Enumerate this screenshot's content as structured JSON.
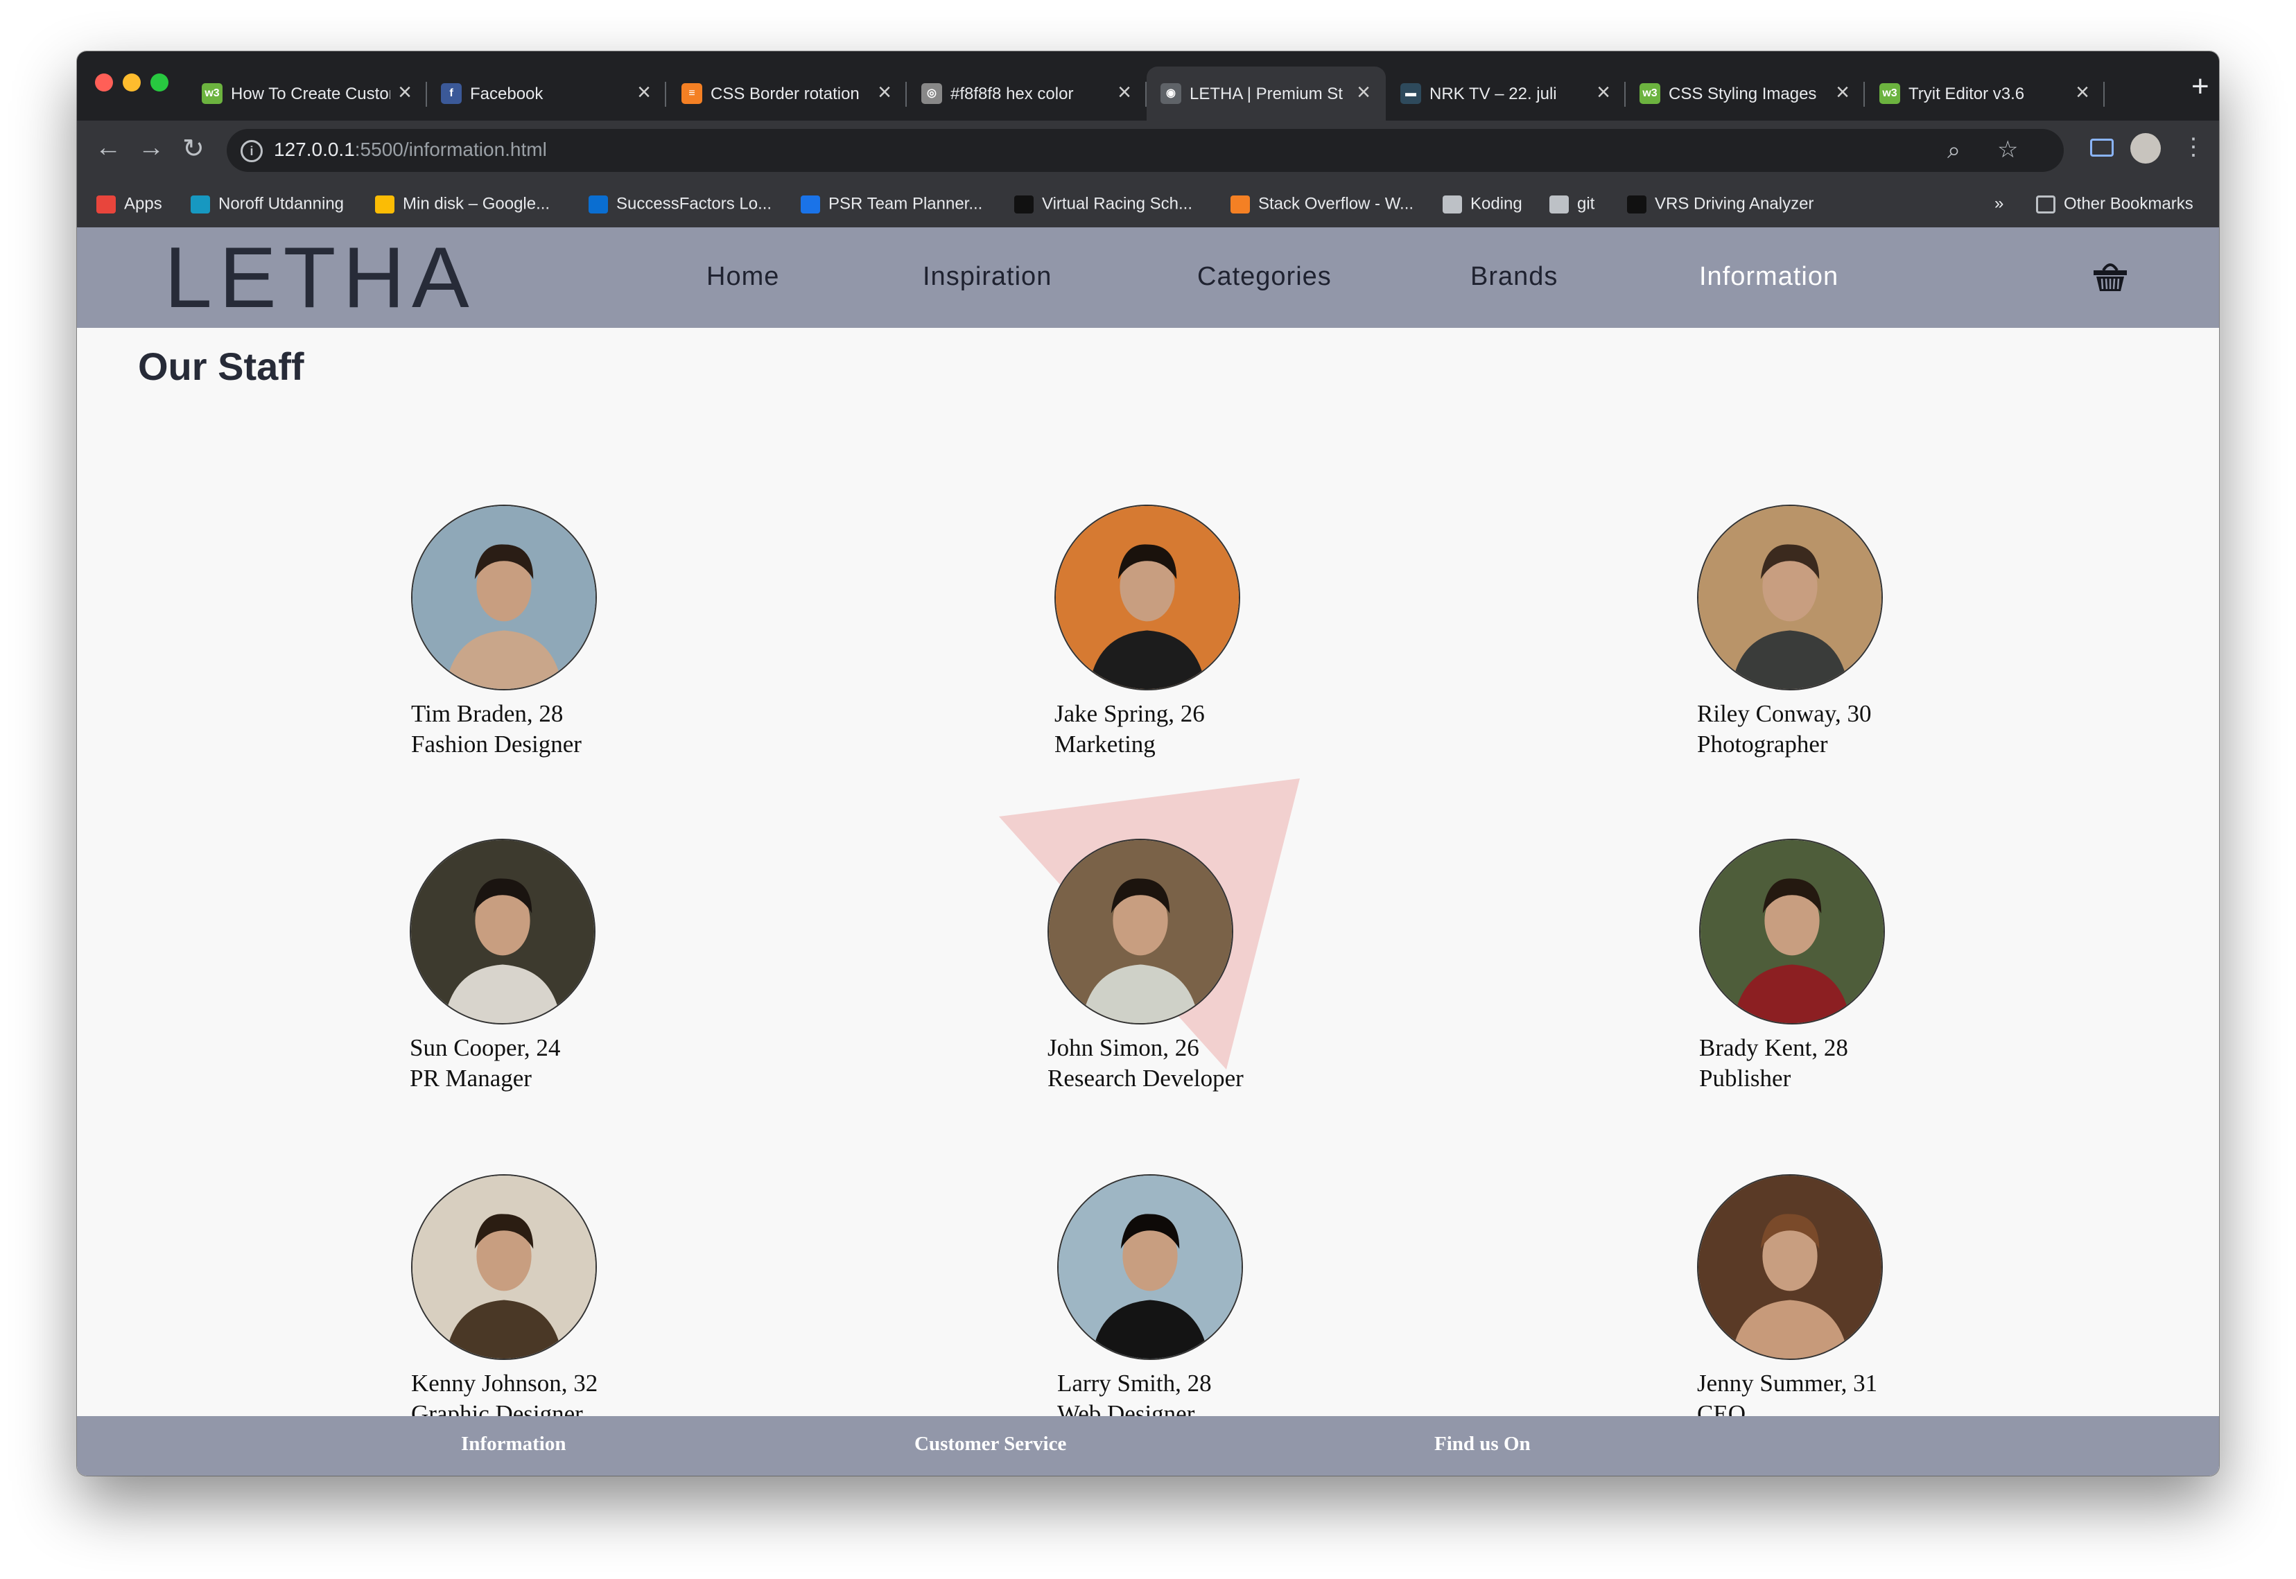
{
  "browser": {
    "tabs": [
      {
        "title": "How To Create Custom",
        "icon": "w3schools-icon",
        "color": "#6cb33f",
        "glyph": "w3"
      },
      {
        "title": "Facebook",
        "icon": "facebook-icon",
        "color": "#3b5998",
        "glyph": "f"
      },
      {
        "title": "CSS Border rotation",
        "icon": "stackoverflow-icon",
        "color": "#f48024",
        "glyph": "≡"
      },
      {
        "title": "#f8f8f8 hex color",
        "icon": "colorhexa-icon",
        "color": "#888888",
        "glyph": "◎"
      },
      {
        "title": "LETHA | Premium St",
        "icon": "globe-icon",
        "color": "#5f6368",
        "glyph": "◉",
        "active": true
      },
      {
        "title": "NRK TV – 22. juli",
        "icon": "nrk-icon",
        "color": "#2e4a5c",
        "glyph": "▬"
      },
      {
        "title": "CSS Styling Images",
        "icon": "w3schools-icon",
        "color": "#6cb33f",
        "glyph": "w3"
      },
      {
        "title": "Tryit Editor v3.6",
        "icon": "w3schools-icon",
        "color": "#6cb33f",
        "glyph": "w3"
      }
    ],
    "url_host": "127.0.0.1",
    "url_path": ":5500/information.html",
    "bookmarks": [
      {
        "label": "Apps",
        "icon": "apps-grid-icon",
        "color": "#e8453c"
      },
      {
        "label": "Noroff Utdanning",
        "icon": "salesforce-icon",
        "color": "#1798c1"
      },
      {
        "label": "Min disk – Google...",
        "icon": "google-drive-icon",
        "color": "#fbbc05"
      },
      {
        "label": "SuccessFactors Lo...",
        "icon": "successfactors-icon",
        "color": "#0a6ed1"
      },
      {
        "label": "PSR Team Planner...",
        "icon": "psr-icon",
        "color": "#1a73e8"
      },
      {
        "label": "Virtual Racing Sch...",
        "icon": "vrs-icon",
        "color": "#111111"
      },
      {
        "label": "Stack Overflow - W...",
        "icon": "stackoverflow-icon",
        "color": "#f48024"
      },
      {
        "label": "Koding",
        "icon": "folder-icon",
        "color": "#bdc1c6"
      },
      {
        "label": "git",
        "icon": "git-icon",
        "color": "#bdc1c6"
      },
      {
        "label": "VRS Driving Analyzer",
        "icon": "vrs-icon",
        "color": "#111111"
      }
    ],
    "overflow": "»",
    "other_bookmarks": "Other Bookmarks"
  },
  "site": {
    "logo": "LETHA",
    "nav": [
      "Home",
      "Inspiration",
      "Categories",
      "Brands",
      "Information"
    ],
    "active_nav": "Information",
    "cart_icon": "shopping-basket-icon",
    "header_color": "#9297a9"
  },
  "page_title": "Our Staff",
  "staff": [
    {
      "name": "Tim Braden, 28",
      "role": "Fashion Designer",
      "bg": "#8fa8b8",
      "fg": "#c9a68a",
      "hair": "#2a1d15"
    },
    {
      "name": "Jake Spring, 26",
      "role": "Marketing",
      "bg": "#d67a32",
      "fg": "#1c1c1c",
      "hair": "#1a120c"
    },
    {
      "name": "Riley Conway, 30",
      "role": "Photographer",
      "bg": "#b99469",
      "fg": "#3a3c3a",
      "hair": "#3b2a1e"
    },
    {
      "name": "Sun Cooper, 24",
      "role": "PR Manager",
      "bg": "#3d3a2e",
      "fg": "#d8d4cc",
      "hair": "#1a1410"
    },
    {
      "name": "John Simon, 26",
      "role": "Research Developer",
      "bg": "#7a6248",
      "fg": "#cfd1c8",
      "hair": "#1c140e"
    },
    {
      "name": "Brady Kent, 28",
      "role": "Publisher",
      "bg": "#4e5d3a",
      "fg": "#8c1f22",
      "hair": "#241910"
    },
    {
      "name": "Kenny Johnson, 32",
      "role": "Graphic Designer",
      "bg": "#d8cfc0",
      "fg": "#4a3826",
      "hair": "#2b1d12"
    },
    {
      "name": "Larry Smith, 28",
      "role": "Web Designer",
      "bg": "#9eb6c4",
      "fg": "#141414",
      "hair": "#0e0a08"
    },
    {
      "name": "Jenny Summer, 31",
      "role": "CEO",
      "bg": "#5a3a26",
      "fg": "#c79a7a",
      "hair": "#7a4a2a"
    }
  ],
  "footer": {
    "links": [
      "Information",
      "Customer Service",
      "Find us On"
    ]
  },
  "accent_triangle_color": "#f2d0cf"
}
